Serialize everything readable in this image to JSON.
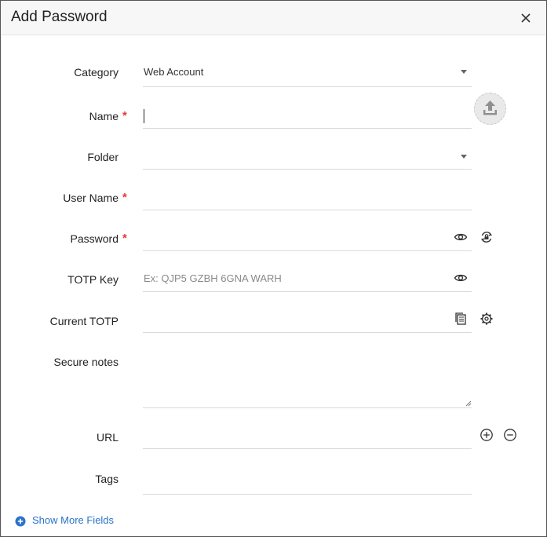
{
  "dialog": {
    "title": "Add Password",
    "close_icon": "close-icon"
  },
  "fields": {
    "category": {
      "label": "Category",
      "value": "Web Account"
    },
    "name": {
      "label": "Name",
      "required_mark": "*",
      "value": ""
    },
    "folder": {
      "label": "Folder",
      "value": ""
    },
    "username": {
      "label": "User Name",
      "required_mark": "*",
      "value": ""
    },
    "password": {
      "label": "Password",
      "required_mark": "*",
      "value": ""
    },
    "totp_key": {
      "label": "TOTP Key",
      "placeholder": "Ex: QJP5 GZBH 6GNA WARH"
    },
    "current_totp": {
      "label": "Current TOTP",
      "value": ""
    },
    "secure_notes": {
      "label": "Secure notes",
      "value": ""
    },
    "url": {
      "label": "URL",
      "value": ""
    },
    "tags": {
      "label": "Tags",
      "value": ""
    }
  },
  "footer": {
    "show_more_label": "Show More Fields"
  },
  "colors": {
    "required": "#e53935",
    "link": "#2a73c9",
    "header_bg": "#f7f7f7"
  }
}
